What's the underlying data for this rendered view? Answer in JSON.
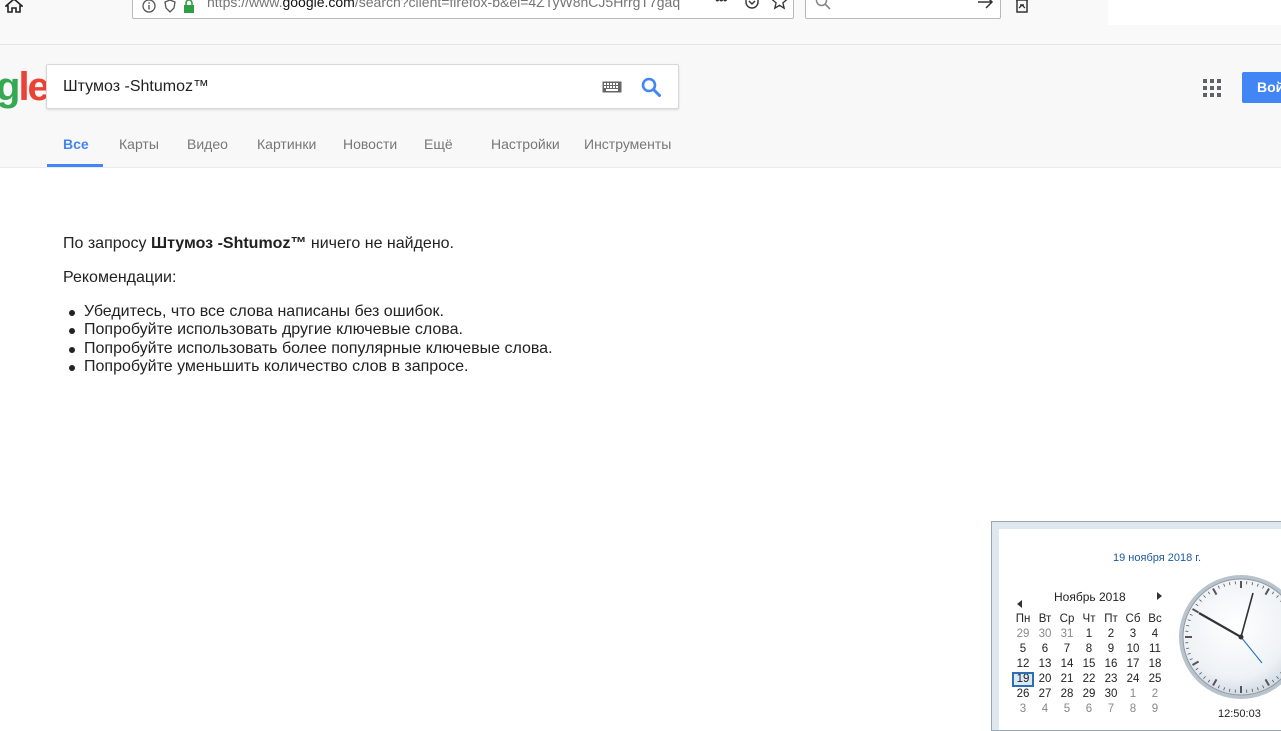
{
  "browser": {
    "url_prefix": "https://www.",
    "url_host": "google.com",
    "url_rest": "/search?client=firefox-b&ei=4ZTyW8nCJ5HrrgT7gaq",
    "more_label": "•••"
  },
  "search": {
    "logo_partial_g": "g",
    "logo_partial_e": "le",
    "query": "Штумоз -Shtumoz™",
    "signin_label": "Войти"
  },
  "tabs": [
    {
      "label": "Все",
      "active": true
    },
    {
      "label": "Карты"
    },
    {
      "label": "Видео"
    },
    {
      "label": "Картинки"
    },
    {
      "label": "Новости"
    },
    {
      "label": "Ещё"
    },
    {
      "label": "Настройки"
    },
    {
      "label": "Инструменты"
    }
  ],
  "results": {
    "msg_prefix": "По запросу ",
    "msg_query": "Штумоз -Shtumoz™",
    "msg_suffix": " ничего не найдено.",
    "recommendations_title": "Рекомендации:",
    "tips": [
      "Убедитесь, что все слова написаны без ошибок.",
      "Попробуйте использовать другие ключевые слова.",
      "Попробуйте использовать более популярные ключевые слова.",
      "Попробуйте уменьшить количество слов в запросе."
    ]
  },
  "calendar": {
    "full_date": "19 ноября 2018 г.",
    "month_label": "Ноябрь 2018",
    "weekdays": [
      "Пн",
      "Вт",
      "Ср",
      "Чт",
      "Пт",
      "Сб",
      "Вс"
    ],
    "weeks": [
      [
        "29",
        "30",
        "31",
        "1",
        "2",
        "3",
        "4"
      ],
      [
        "5",
        "6",
        "7",
        "8",
        "9",
        "10",
        "11"
      ],
      [
        "12",
        "13",
        "14",
        "15",
        "16",
        "17",
        "18"
      ],
      [
        "19",
        "20",
        "21",
        "22",
        "23",
        "24",
        "25"
      ],
      [
        "26",
        "27",
        "28",
        "29",
        "30",
        "1",
        "2"
      ],
      [
        "3",
        "4",
        "5",
        "6",
        "7",
        "8",
        "9"
      ]
    ],
    "today": "19",
    "time": "12:50:03"
  },
  "colors": {
    "accent": "#4285f4",
    "logo_green": "#34a853",
    "logo_red": "#ea4335",
    "lock_green": "#2ea043"
  }
}
